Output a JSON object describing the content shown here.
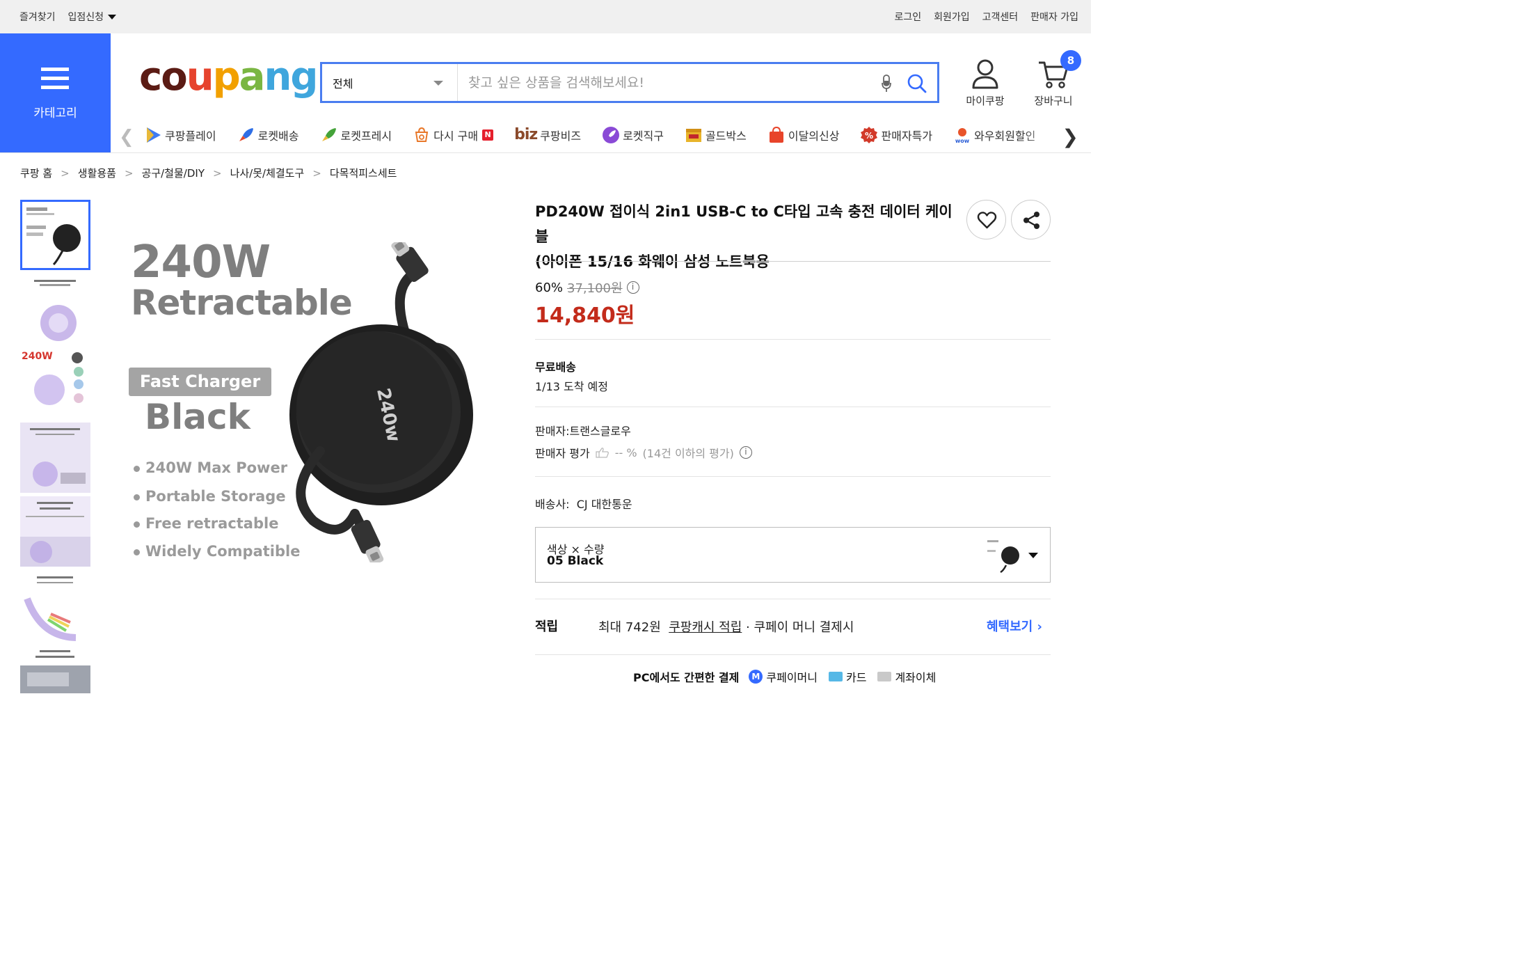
{
  "utility": {
    "favorites": "즐겨찾기",
    "store_apply": "입점신청",
    "login": "로그인",
    "signup": "회원가입",
    "customer_center": "고객센터",
    "seller_signup": "판매자 가입"
  },
  "header": {
    "category_label": "카테고리",
    "logo_letters": [
      "c",
      "o",
      "u",
      "p",
      "a",
      "ng"
    ],
    "search_category": "전체",
    "search_placeholder": "찾고 싶은 상품을 검색해보세요!",
    "my_coupang": "마이쿠팡",
    "cart": "장바구니",
    "cart_count": "8"
  },
  "nav": {
    "items": [
      {
        "label": "쿠팡플레이",
        "icon": "play-icon"
      },
      {
        "label": "로켓배송",
        "icon": "rocket-icon"
      },
      {
        "label": "로켓프레시",
        "icon": "rocket-fresh-icon"
      },
      {
        "label": "다시 구매",
        "icon": "rebuy-icon",
        "badge": "N"
      },
      {
        "label": "쿠팡비즈",
        "prefix": "biz"
      },
      {
        "label": "로켓직구",
        "icon": "rocket-global-icon"
      },
      {
        "label": "골드박스",
        "icon": "goldbox-icon"
      },
      {
        "label": "이달의신상",
        "icon": "new-bag-icon"
      },
      {
        "label": "판매자특가",
        "icon": "percent-icon"
      },
      {
        "label": "와우회원할인",
        "icon": "wow-icon"
      }
    ]
  },
  "breadcrumb": [
    "쿠팡 홈",
    "생활용품",
    "공구/철물/DIY",
    "나사/못/체결도구",
    "다목적피스세트"
  ],
  "main_image": {
    "headline_1": "240W",
    "headline_2": "Retractable",
    "pill": "Fast Charger",
    "color": "Black",
    "features": [
      "240W Max Power",
      "Portable Storage",
      "Free retractable",
      "Widely Compatible"
    ],
    "product_mark": "240w"
  },
  "product": {
    "title_line1": "PD240W 접이식 2in1 USB-C to C타입 고속 충전 데이터 케이블",
    "title_line2": "(아이폰 15/16 화웨이 삼성 노트북용",
    "discount": "60%",
    "original_price": "37,100원",
    "price": "14,840원",
    "shipping_title": "무료배송",
    "shipping_eta": "1/13 도착 예정",
    "seller": "판매자:트랜스글로우",
    "seller_rating_label": "판매자 평가",
    "seller_rating_value": "-- %",
    "seller_rating_note": "(14건 이하의 평가)",
    "courier_label": "배송사:",
    "courier": "CJ 대한통운",
    "option_label": "색상 × 수량",
    "option_value": "05 Black",
    "reward_label": "적립",
    "reward_amount": "최대 742원",
    "reward_link": "쿠팡캐시 적립",
    "reward_suffix": " · 쿠페이 머니 결제시",
    "benefit_link": "혜택보기",
    "pay_title": "PC에서도 간편한 결제",
    "pay_methods": [
      "쿠페이머니",
      "카드",
      "계좌이체"
    ]
  },
  "colors": {
    "brand_blue": "#346aff",
    "price_red": "#c32b1b"
  }
}
